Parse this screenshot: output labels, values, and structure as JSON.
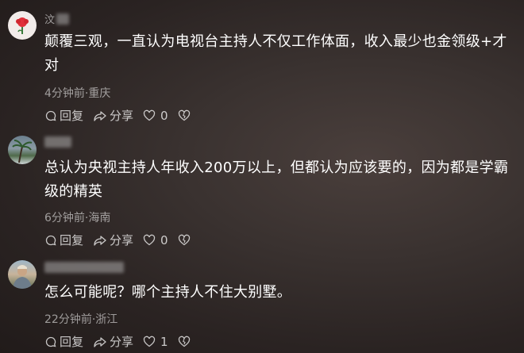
{
  "comments": [
    {
      "username": "汶",
      "text": "颠覆三观，一直认为电视台主持人不仅工作体面，收入最少也金领级+才对",
      "meta": "4分钟前·重庆",
      "reply_label": "回复",
      "share_label": "分享",
      "like_count": "0"
    },
    {
      "username": "",
      "text": "总认为央视主持人年收入200万以上，但都认为应该要的，因为都是学霸级的精英",
      "meta": "6分钟前·海南",
      "reply_label": "回复",
      "share_label": "分享",
      "like_count": "0"
    },
    {
      "username": "",
      "text": "怎么可能呢？哪个主持人不住大别墅。",
      "meta": "22分钟前·浙江",
      "reply_label": "回复",
      "share_label": "分享",
      "like_count": "1"
    }
  ]
}
